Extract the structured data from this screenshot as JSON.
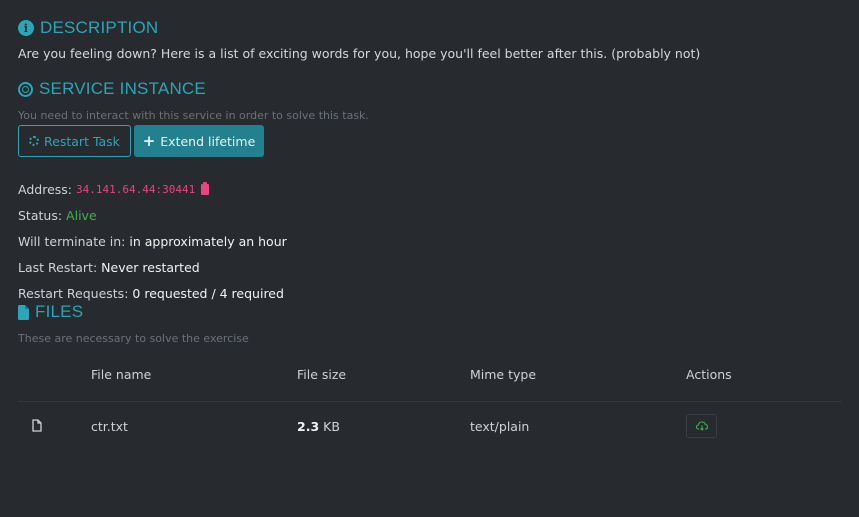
{
  "description": {
    "title": "DESCRIPTION",
    "text": "Are you feeling down? Here is a list of exciting words for you, hope you'll feel better after this. (probably not)"
  },
  "service": {
    "title": "SERVICE INSTANCE",
    "hint": "You need to interact with this service in order to solve this task.",
    "restart_label": "Restart Task",
    "extend_label": "Extend lifetime",
    "address_label": "Address:",
    "address_value": "34.141.64.44:30441",
    "status_label": "Status:",
    "status_value": "Alive",
    "terminate_label": "Will terminate in:",
    "terminate_value": "in approximately an hour",
    "last_restart_label": "Last Restart:",
    "last_restart_value": "Never restarted",
    "requests_label": "Restart Requests:",
    "requests_value": "0 requested / 4 required"
  },
  "files": {
    "title": "FILES",
    "hint": "These are necessary to solve the exercise",
    "columns": [
      "File name",
      "File size",
      "Mime type",
      "Actions"
    ],
    "rows": [
      {
        "name": "ctr.txt",
        "size_number": "2.3",
        "size_unit": "KB",
        "mime": "text/plain"
      }
    ]
  },
  "icons": {
    "description": "info-circle-icon",
    "service": "target-icon",
    "files": "file-icon",
    "copy": "clipboard-icon",
    "restart": "spinner-icon",
    "extend": "plus-icon",
    "download": "cloud-download-icon"
  },
  "colors": {
    "accent": "#2aa6b8",
    "address": "#e8457e",
    "alive": "#3fb24a",
    "background": "#272a2e"
  }
}
